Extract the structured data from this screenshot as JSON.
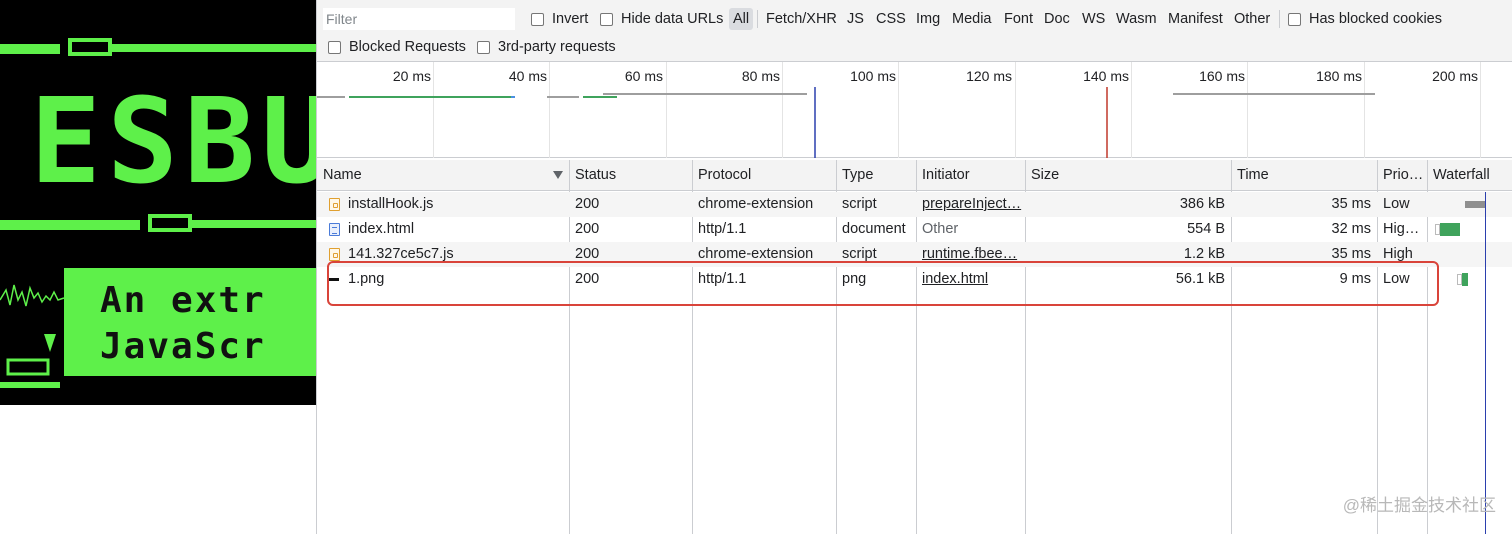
{
  "banner": {
    "logo_text": "ESBU",
    "tagline_line1": "An extr",
    "tagline_line2": "JavaScr"
  },
  "toolbar": {
    "filter_placeholder": "Filter",
    "invert_label": "Invert",
    "hide_data_urls_label": "Hide data URLs",
    "type_filters": [
      "All",
      "Fetch/XHR",
      "JS",
      "CSS",
      "Img",
      "Media",
      "Font",
      "Doc",
      "WS",
      "Wasm",
      "Manifest",
      "Other"
    ],
    "active_type": "All",
    "has_blocked_cookies_label": "Has blocked cookies",
    "blocked_requests_label": "Blocked Requests",
    "third_party_label": "3rd-party requests"
  },
  "overview": {
    "tick_labels": [
      "20 ms",
      "40 ms",
      "60 ms",
      "80 ms",
      "100 ms",
      "120 ms",
      "140 ms",
      "160 ms",
      "180 ms",
      "200 ms"
    ]
  },
  "table": {
    "columns": [
      "Name",
      "Status",
      "Protocol",
      "Type",
      "Initiator",
      "Size",
      "Time",
      "Prio…",
      "Waterfall"
    ],
    "rows": [
      {
        "name": "installHook.js",
        "icon": "script-file-icon",
        "status": "200",
        "protocol": "chrome-extension",
        "type": "script",
        "initiator": "prepareInject…",
        "size": "386 kB",
        "time": "35 ms",
        "priority": "Low"
      },
      {
        "name": "index.html",
        "icon": "document-file-icon",
        "status": "200",
        "protocol": "http/1.1",
        "type": "document",
        "initiator": "Other",
        "size": "554 B",
        "time": "32 ms",
        "priority": "Hig…"
      },
      {
        "name": "141.327ce5c7.js",
        "icon": "script-file-icon",
        "status": "200",
        "protocol": "chrome-extension",
        "type": "script",
        "initiator": "runtime.fbee…",
        "size": "1.2 kB",
        "time": "35 ms",
        "priority": "High"
      },
      {
        "name": "1.png",
        "icon": "image-file-icon",
        "status": "200",
        "protocol": "http/1.1",
        "type": "png",
        "initiator": "index.html",
        "size": "56.1 kB",
        "time": "9 ms",
        "priority": "Low"
      }
    ]
  },
  "watermark": "@稀土掘金技术社区",
  "colors": {
    "banner_green": "#5ef04a",
    "highlight_red": "#d9443a",
    "dom_content_loaded_line": "#2b3fae",
    "load_line": "#c0392b",
    "waterfall_green": "#3fa35c"
  }
}
